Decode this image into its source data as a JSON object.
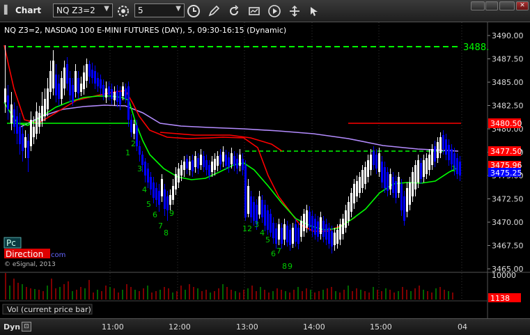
{
  "window": {
    "title": "Chart",
    "app_icon": "window-menu-icon",
    "close_glyph": "✕"
  },
  "toolbar": {
    "symbol": "NQ Z3=2",
    "interval": "5",
    "dropdown_glyph": "▼",
    "icons": [
      "gear-icon",
      "clock-icon",
      "pencil-icon",
      "refresh-icon",
      "study-icon",
      "play-icon",
      "pan-icon"
    ]
  },
  "chart": {
    "header": "NQ Z3=2, NASDAQ 100 E-MINI FUTURES (DAY), 5, 09:30-16:15 (Dynamic)",
    "logo_pc": "Pc",
    "logo_direction": "Direction",
    "logo_suffix": "com",
    "copyright": "© eSignal, 2013",
    "colors": {
      "background": "#000000",
      "up_candle": "#ffffff",
      "down_candle": "#0000ff",
      "red_line": "#ff0000",
      "green_line": "#00ff00",
      "purple_line": "#b48cff",
      "dashed_line": "#00ff00",
      "count_label": "#00cc00"
    },
    "price_axis": {
      "labels": [
        "3490.00",
        "3487.50",
        "3485.00",
        "3482.50",
        "3480.00",
        "3477.50",
        "3475.00",
        "3472.50",
        "3470.00",
        "3467.50",
        "3465.00"
      ],
      "markers": [
        {
          "text": "3488.",
          "color": "#00ff00",
          "style": "inline"
        },
        {
          "text": "3480.50",
          "color": "#ff0000",
          "style": "box"
        },
        {
          "text": "3477.50",
          "color": "#ff0000",
          "style": "box"
        },
        {
          "text": "3475.96",
          "color": "#ff0000",
          "style": "box"
        },
        {
          "text": "3475.25",
          "color": "#0000ff",
          "style": "box"
        }
      ]
    },
    "count_labels": [
      "1",
      "2",
      "3",
      "4",
      "5",
      "6",
      "7",
      "8",
      "9",
      "12",
      "3",
      "4",
      "5",
      "6",
      "7",
      "8",
      "9",
      "1"
    ]
  },
  "volume": {
    "label": "Vol (current price bar)",
    "axis_label": "10000",
    "current": "1138",
    "current_color": "#ff0000"
  },
  "bottom": {
    "mode": "Dyn",
    "time_labels": [
      "11:00",
      "12:00",
      "13:00",
      "14:00",
      "15:00",
      "04"
    ]
  }
}
